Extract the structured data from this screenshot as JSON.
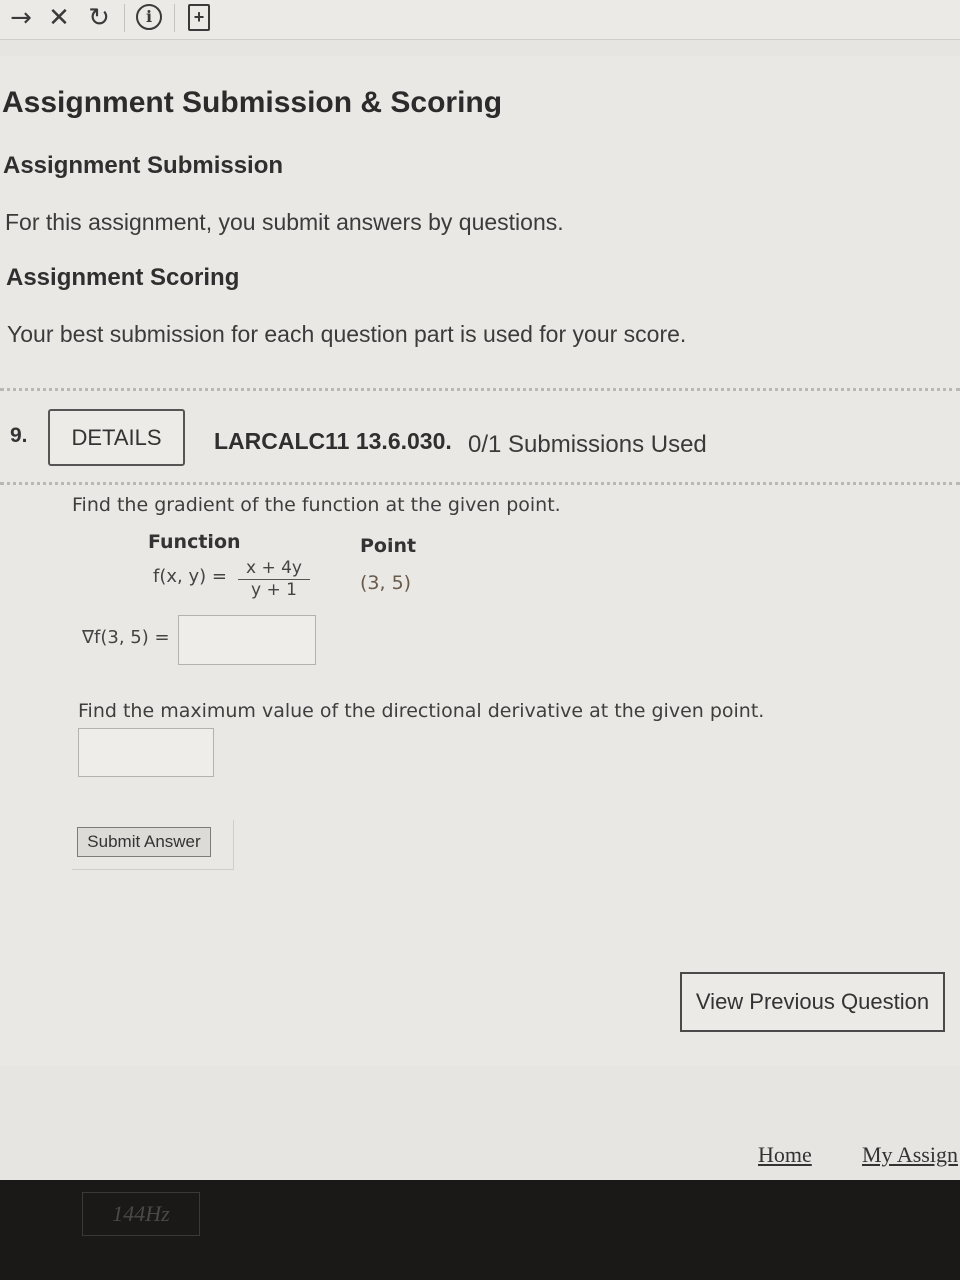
{
  "toolbar": {
    "forward_icon": "→",
    "close_icon": "✕",
    "reload_icon": "↻",
    "info_icon": "i",
    "add_icon": "+"
  },
  "header": {
    "title": "Assignment Submission & Scoring",
    "submission_heading": "Assignment Submission",
    "submission_text": "For this assignment, you submit answers by questions.",
    "scoring_heading": "Assignment Scoring",
    "scoring_text": "Your best submission for each question part is used for your score."
  },
  "question": {
    "number": "9.",
    "details_label": "DETAILS",
    "id": "LARCALC11 13.6.030.",
    "submissions": "0/1 Submissions Used",
    "prompt": "Find the gradient of the function at the given point.",
    "function_header": "Function",
    "point_header": "Point",
    "function_lhs": "f(x, y)  =",
    "numerator": "x + 4y",
    "denominator": "y + 1",
    "point": "(3, 5)",
    "gradient_label": "∇f(3, 5) =",
    "gradient_value": "",
    "prompt2": "Find the maximum value of the directional derivative at the given point.",
    "max_value": "",
    "submit_label": "Submit Answer"
  },
  "nav": {
    "view_previous": "View Previous Question",
    "home": "Home",
    "my_assignments": "My Assign"
  },
  "bezel": {
    "label": "144Hz"
  }
}
